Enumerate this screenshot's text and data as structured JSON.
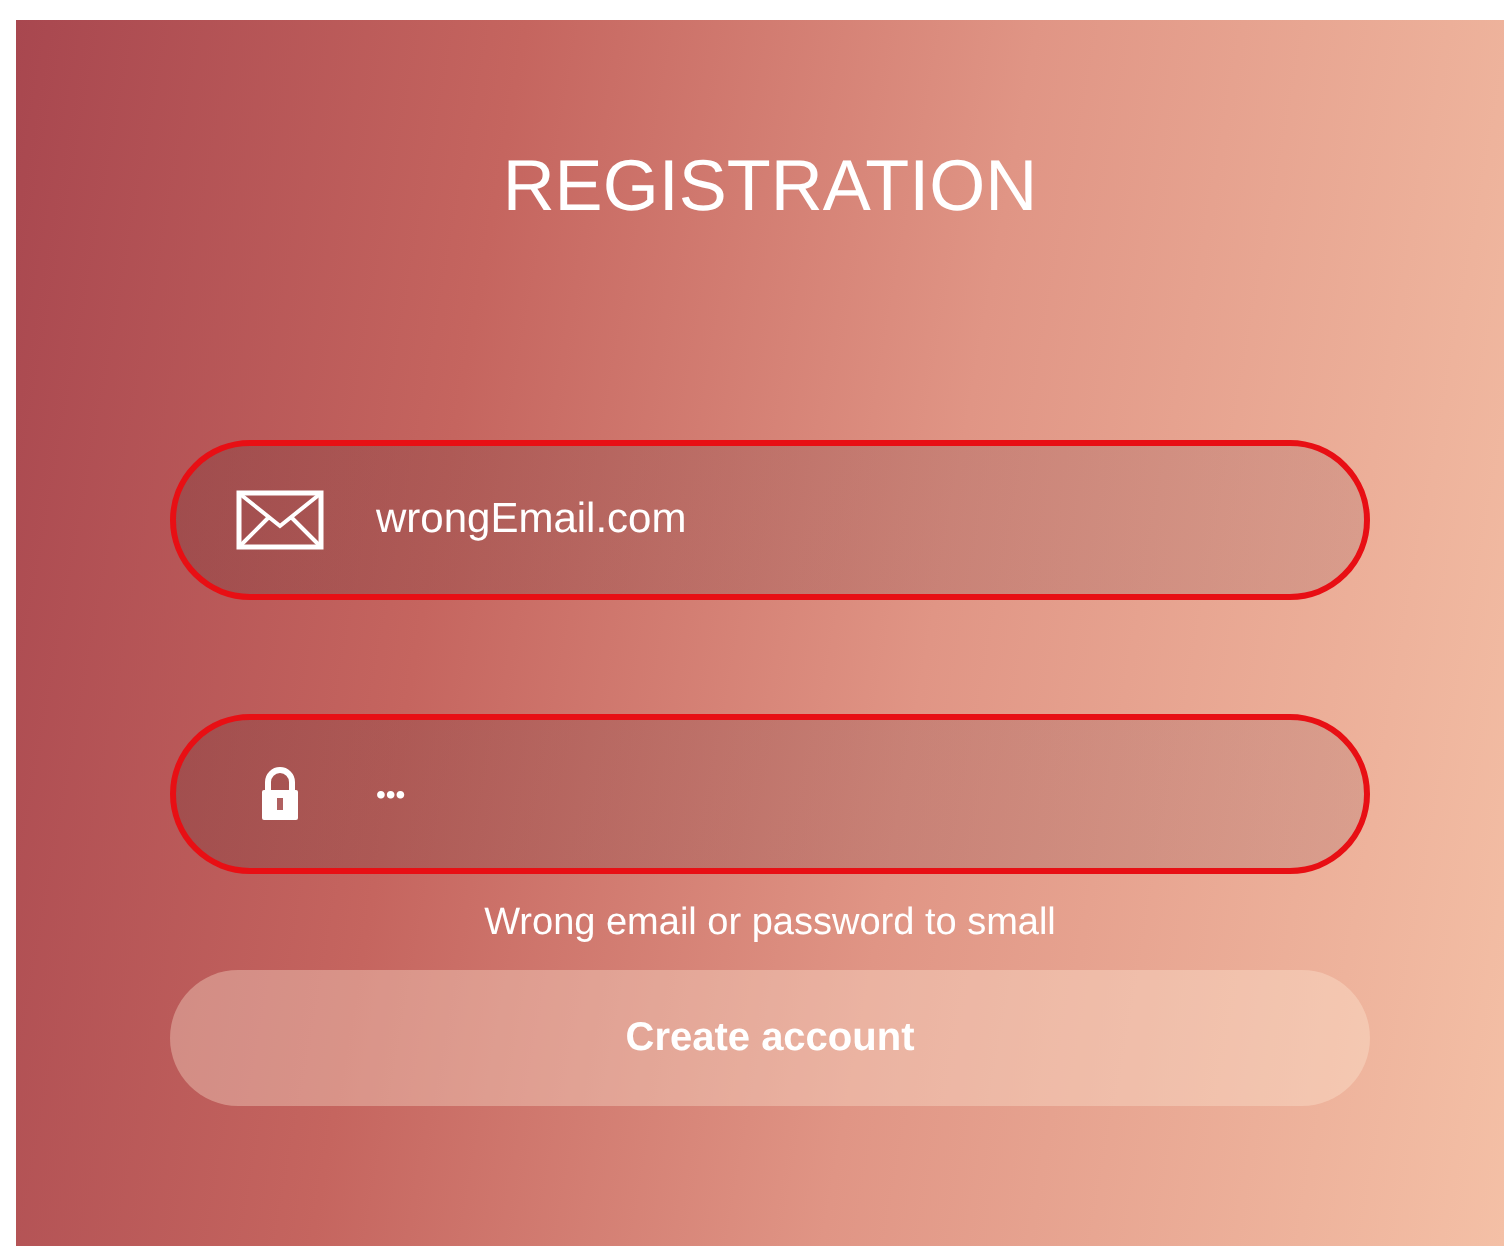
{
  "title": "REGISTRATION",
  "fields": [
    {
      "kind": "email",
      "value": "wrongEmail.com",
      "invalid": true
    },
    {
      "kind": "password",
      "value": "•••",
      "invalid": true
    }
  ],
  "error": "Wrong email or password to small",
  "button": {
    "label": "Create account",
    "disabled": true
  }
}
